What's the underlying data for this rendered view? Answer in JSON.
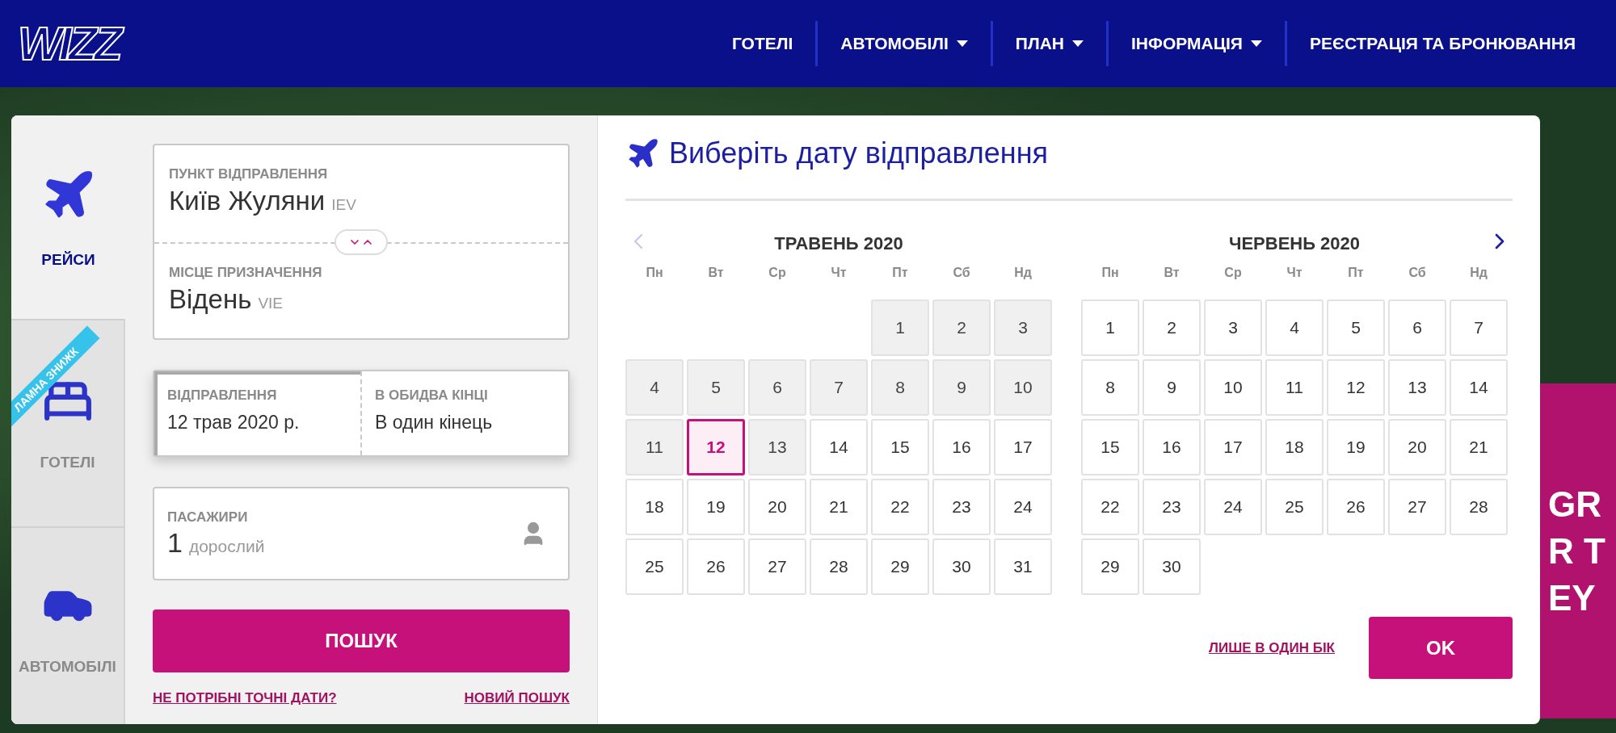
{
  "header": {
    "logo": "WIZZ",
    "nav": [
      {
        "label": "ГОТЕЛІ",
        "has_menu": false
      },
      {
        "label": "АВТОМОБІЛІ",
        "has_menu": true
      },
      {
        "label": "ПЛАН",
        "has_menu": true
      },
      {
        "label": "ІНФОРМАЦІЯ",
        "has_menu": true
      },
      {
        "label": "РЕЄСТРАЦІЯ ТА БРОНЮВАННЯ",
        "has_menu": false
      }
    ]
  },
  "promo": {
    "lines": [
      "GR",
      "R T",
      "EY"
    ]
  },
  "tabs": [
    {
      "kind": "flights",
      "label": "РЕЙСИ",
      "selected": true
    },
    {
      "kind": "hotels",
      "label": "ГОТЕЛІ",
      "selected": false,
      "ribbon": "ЛАМНА ЗНИЖК"
    },
    {
      "kind": "cars",
      "label": "АВТОМОБІЛІ",
      "selected": false
    }
  ],
  "form": {
    "origin": {
      "label": "ПУНКТ ВІДПРАВЛЕННЯ",
      "city": "Київ Жуляни",
      "code": "IEV"
    },
    "destination": {
      "label": "МІСЦЕ ПРИЗНАЧЕННЯ",
      "city": "Відень",
      "code": "VIE"
    },
    "departure": {
      "label": "ВІДПРАВЛЕННЯ",
      "value": "12 трав 2020 р.",
      "selected": true
    },
    "return": {
      "label": "В ОБИДВА КІНЦІ",
      "value": "В один кінець",
      "selected": false
    },
    "passengers": {
      "label": "ПАСАЖИРИ",
      "count": "1",
      "unit": "дорослий"
    },
    "search_button": "ПОШУК",
    "links": [
      "НЕ ПОТРІБНІ ТОЧНІ ДАТИ?",
      "НОВИЙ ПОШУК"
    ]
  },
  "calendar": {
    "title": "Виберіть дату відправлення",
    "prev_disabled": true,
    "next_disabled": false,
    "months": [
      {
        "title": "ТРАВЕНЬ 2020",
        "weekdays": [
          "Пн",
          "Вт",
          "Ср",
          "Чт",
          "Пт",
          "Сб",
          "Нд"
        ],
        "days": [
          {
            "kind": "blank"
          },
          {
            "kind": "blank"
          },
          {
            "kind": "blank"
          },
          {
            "kind": "blank"
          },
          {
            "kind": "day",
            "label": "1",
            "disabled": true,
            "selected": false
          },
          {
            "kind": "day",
            "label": "2",
            "disabled": true,
            "selected": false
          },
          {
            "kind": "day",
            "label": "3",
            "disabled": true,
            "selected": false
          },
          {
            "kind": "day",
            "label": "4",
            "disabled": true,
            "selected": false
          },
          {
            "kind": "day",
            "label": "5",
            "disabled": true,
            "selected": false
          },
          {
            "kind": "day",
            "label": "6",
            "disabled": true,
            "selected": false
          },
          {
            "kind": "day",
            "label": "7",
            "disabled": true,
            "selected": false
          },
          {
            "kind": "day",
            "label": "8",
            "disabled": true,
            "selected": false
          },
          {
            "kind": "day",
            "label": "9",
            "disabled": true,
            "selected": false
          },
          {
            "kind": "day",
            "label": "10",
            "disabled": true,
            "selected": false
          },
          {
            "kind": "day",
            "label": "11",
            "disabled": true,
            "selected": false
          },
          {
            "kind": "day",
            "label": "12",
            "disabled": false,
            "selected": true
          },
          {
            "kind": "day",
            "label": "13",
            "disabled": true,
            "selected": false
          },
          {
            "kind": "day",
            "label": "14",
            "disabled": false,
            "selected": false
          },
          {
            "kind": "day",
            "label": "15",
            "disabled": false,
            "selected": false
          },
          {
            "kind": "day",
            "label": "16",
            "disabled": false,
            "selected": false
          },
          {
            "kind": "day",
            "label": "17",
            "disabled": false,
            "selected": false
          },
          {
            "kind": "day",
            "label": "18",
            "disabled": false,
            "selected": false
          },
          {
            "kind": "day",
            "label": "19",
            "disabled": false,
            "selected": false
          },
          {
            "kind": "day",
            "label": "20",
            "disabled": false,
            "selected": false
          },
          {
            "kind": "day",
            "label": "21",
            "disabled": false,
            "selected": false
          },
          {
            "kind": "day",
            "label": "22",
            "disabled": false,
            "selected": false
          },
          {
            "kind": "day",
            "label": "23",
            "disabled": false,
            "selected": false
          },
          {
            "kind": "day",
            "label": "24",
            "disabled": false,
            "selected": false
          },
          {
            "kind": "day",
            "label": "25",
            "disabled": false,
            "selected": false
          },
          {
            "kind": "day",
            "label": "26",
            "disabled": false,
            "selected": false
          },
          {
            "kind": "day",
            "label": "27",
            "disabled": false,
            "selected": false
          },
          {
            "kind": "day",
            "label": "28",
            "disabled": false,
            "selected": false
          },
          {
            "kind": "day",
            "label": "29",
            "disabled": false,
            "selected": false
          },
          {
            "kind": "day",
            "label": "30",
            "disabled": false,
            "selected": false
          },
          {
            "kind": "day",
            "label": "31",
            "disabled": false,
            "selected": false
          }
        ]
      },
      {
        "title": "ЧЕРВЕНЬ 2020",
        "weekdays": [
          "Пн",
          "Вт",
          "Ср",
          "Чт",
          "Пт",
          "Сб",
          "Нд"
        ],
        "days": [
          {
            "kind": "day",
            "label": "1",
            "disabled": false,
            "selected": false
          },
          {
            "kind": "day",
            "label": "2",
            "disabled": false,
            "selected": false
          },
          {
            "kind": "day",
            "label": "3",
            "disabled": false,
            "selected": false
          },
          {
            "kind": "day",
            "label": "4",
            "disabled": false,
            "selected": false
          },
          {
            "kind": "day",
            "label": "5",
            "disabled": false,
            "selected": false
          },
          {
            "kind": "day",
            "label": "6",
            "disabled": false,
            "selected": false
          },
          {
            "kind": "day",
            "label": "7",
            "disabled": false,
            "selected": false
          },
          {
            "kind": "day",
            "label": "8",
            "disabled": false,
            "selected": false
          },
          {
            "kind": "day",
            "label": "9",
            "disabled": false,
            "selected": false
          },
          {
            "kind": "day",
            "label": "10",
            "disabled": false,
            "selected": false
          },
          {
            "kind": "day",
            "label": "11",
            "disabled": false,
            "selected": false
          },
          {
            "kind": "day",
            "label": "12",
            "disabled": false,
            "selected": false
          },
          {
            "kind": "day",
            "label": "13",
            "disabled": false,
            "selected": false
          },
          {
            "kind": "day",
            "label": "14",
            "disabled": false,
            "selected": false
          },
          {
            "kind": "day",
            "label": "15",
            "disabled": false,
            "selected": false
          },
          {
            "kind": "day",
            "label": "16",
            "disabled": false,
            "selected": false
          },
          {
            "kind": "day",
            "label": "17",
            "disabled": false,
            "selected": false
          },
          {
            "kind": "day",
            "label": "18",
            "disabled": false,
            "selected": false
          },
          {
            "kind": "day",
            "label": "19",
            "disabled": false,
            "selected": false
          },
          {
            "kind": "day",
            "label": "20",
            "disabled": false,
            "selected": false
          },
          {
            "kind": "day",
            "label": "21",
            "disabled": false,
            "selected": false
          },
          {
            "kind": "day",
            "label": "22",
            "disabled": false,
            "selected": false
          },
          {
            "kind": "day",
            "label": "23",
            "disabled": false,
            "selected": false
          },
          {
            "kind": "day",
            "label": "24",
            "disabled": false,
            "selected": false
          },
          {
            "kind": "day",
            "label": "25",
            "disabled": false,
            "selected": false
          },
          {
            "kind": "day",
            "label": "26",
            "disabled": false,
            "selected": false
          },
          {
            "kind": "day",
            "label": "27",
            "disabled": false,
            "selected": false
          },
          {
            "kind": "day",
            "label": "28",
            "disabled": false,
            "selected": false
          },
          {
            "kind": "day",
            "label": "29",
            "disabled": false,
            "selected": false
          },
          {
            "kind": "day",
            "label": "30",
            "disabled": false,
            "selected": false
          }
        ]
      }
    ],
    "one_way_link": "ЛИШЕ В ОДИН БІК",
    "ok_button": "OK"
  }
}
